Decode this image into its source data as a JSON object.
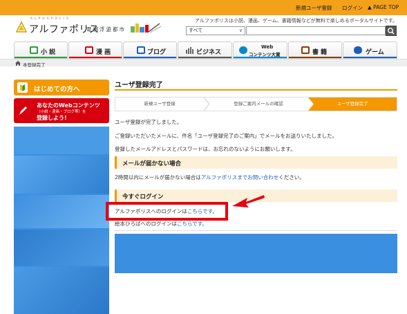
{
  "topbar": {
    "register_label": "新規ユーザ登録",
    "login_label": "ログイン",
    "pagetop_label": "▲ PAGE TOP"
  },
  "logo": {
    "kana": "ALPHAPOLIS",
    "name": "アルファポリス",
    "sub": "電網浮遊都市"
  },
  "header": {
    "tagline": "アルファポリスは小説、漫画、ゲーム、書籍情報などが無料で楽しめるポータルサイトです。",
    "search_select_value": "すべて",
    "search_placeholder": ""
  },
  "nav": {
    "items": [
      {
        "label": "小 説",
        "icon": "novel-icon",
        "color": "#2a9d3a"
      },
      {
        "label": "漫 画",
        "icon": "manga-icon",
        "color": "#d7000f"
      },
      {
        "label": "ブログ",
        "icon": "blog-icon",
        "color": "#1a5fb4"
      },
      {
        "label": "ビジネス",
        "icon": "business-icon",
        "color": "#555555"
      },
      {
        "label_line1": "Web",
        "label_line2": "コンテンツ大賞",
        "icon": "contents-award-icon",
        "color": "#0088cc"
      },
      {
        "label": "書 籍",
        "icon": "book-icon",
        "color": "#8a3c00"
      },
      {
        "label": "ゲーム",
        "icon": "gamepad-icon",
        "color": "#1a5fb4"
      }
    ]
  },
  "breadcrumb": {
    "current": "本登録完了"
  },
  "sidebar": {
    "beginner_label": "はじめての方へ",
    "contents_line1": "あなたのWebコンテンツ",
    "contents_line2": "（小説・漫画・ブログ等）を",
    "contents_line3": "登録しよう!"
  },
  "main": {
    "title": "ユーザ登録完了",
    "steps": [
      "新規ユーザ登録",
      "登録ご案内メールの確認",
      "ユーザ登録完了"
    ],
    "active_step": 3,
    "para1": "ユーザ登録が完了しました。",
    "para2": "ご登録いただいたメールに、件名「ユーザ登録完了のご案内」でメールをお送りいたしました。",
    "para3": "登録したメールアドレスとパスワードは、お忘れのないようにお願いします。",
    "mail_heading": "メールが届かない場合",
    "mail_text_before": "2時間以内にメールが届かない場合は",
    "mail_link": "アルファポリスまでお問い合わせ",
    "mail_text_after": "ください。",
    "login_heading": "今すぐログイン",
    "login_text_before": "アルファポリスへのログインは",
    "login_link": "こちらです。",
    "ehon_text_before": "絵本ひろばへのログインは",
    "ehon_link": "こちらです。"
  },
  "colors": {
    "accent": "#f39800",
    "highlight": "#e60012",
    "link": "#1a5fb4"
  }
}
